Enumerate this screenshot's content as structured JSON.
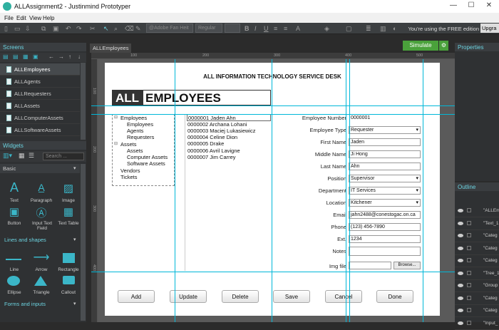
{
  "window": {
    "title": "ALLAssignment2 - Justinmind Prototyper",
    "minimize": "—",
    "maximize": "☐",
    "close": "✕"
  },
  "menubar": [
    "File",
    "Edit",
    "View",
    "Help"
  ],
  "toolbar": {
    "font_name": "@Adobe Fan Heit",
    "font_style": "Regular",
    "free_edition": "You're using the FREE edition",
    "upgrade": "Upgra"
  },
  "screens_panel": {
    "title": "Screens",
    "items": [
      "ALLEmployees",
      "ALLAgents",
      "ALLRequesters",
      "ALLAssets",
      "ALLComputerAssets",
      "ALLSoftwareAssets"
    ],
    "selected": "ALLEmployees"
  },
  "widgets_panel": {
    "title": "Widgets",
    "search_placeholder": "Search ...",
    "category_basic": "Basic",
    "basic_items": [
      "Text",
      "Paragraph",
      "Image",
      "Button",
      "Input Text Field",
      "Text Table"
    ],
    "category_lines": "Lines and shapes",
    "lines_items": [
      "Line",
      "Arrow",
      "Rectangle",
      "Ellipse",
      "Triangle",
      "Callout"
    ],
    "category_forms": "Forms and inputs"
  },
  "canvas": {
    "tab": "ALLEmployees",
    "simulate": "Simulate",
    "ruler_top": [
      "100",
      "200",
      "300",
      "400",
      "500"
    ],
    "ruler_left": [
      "100",
      "200",
      "300",
      "400"
    ]
  },
  "page": {
    "header": "ALL INFORMATION TECHNOLOGY SERVICE DESK",
    "title_box": "ALL",
    "title_rest": "EMPLOYEES",
    "tree": [
      "Employees",
      "Employees",
      "Agents",
      "Requesters",
      "Assets",
      "Assets",
      "Computer Assets",
      "Software Assets",
      "Vendors",
      "Tickets"
    ],
    "employees": [
      "0000001 Jaden Ahn",
      "0000002 Archana Lohani",
      "0000003 Maciej Lukasiewicz",
      "0000004 Celine Dion",
      "0000005 Drake",
      "0000006 Avril Lavigne",
      "0000007 Jim Carrey"
    ],
    "form": {
      "employee_number": {
        "label": "Employee Number",
        "value": "0000001"
      },
      "employee_type": {
        "label": "Employee Type",
        "value": "Requester"
      },
      "first_name": {
        "label": "First Name",
        "value": "Jaden"
      },
      "middle_name": {
        "label": "Middle Name",
        "value": "Ji Hong"
      },
      "last_name": {
        "label": "Last Name",
        "value": "Ahn"
      },
      "position": {
        "label": "Position",
        "value": "Supervisor"
      },
      "department": {
        "label": "Department",
        "value": "IT Services"
      },
      "location": {
        "label": "Location",
        "value": "Kitchener"
      },
      "email": {
        "label": "Email",
        "value": "jahn2488@conestogac.on.ca"
      },
      "phone": {
        "label": "Phone",
        "value": "(123) 456-7890"
      },
      "ext": {
        "label": "Ext.",
        "value": "1234"
      },
      "notes": {
        "label": "Notes",
        "value": ""
      },
      "img_file": {
        "label": "Img file",
        "value": "",
        "browse": "Browse..."
      }
    },
    "buttons": [
      "Add",
      "Update",
      "Delete",
      "Save",
      "Cancel",
      "Done"
    ]
  },
  "properties_panel": {
    "title": "Properties"
  },
  "outline_panel": {
    "title": "Outline",
    "rows": [
      "\"ALLEm",
      "\"Text_1",
      "\"Categ",
      "\"Categ",
      "\"Categ",
      "\"Tree_1",
      "\"Group",
      "\"Categ",
      "\"Categ",
      "\"Input_"
    ]
  },
  "colors": {
    "accent": "#00b7d8",
    "simulate": "#4aa13b",
    "panel": "#2f3133"
  }
}
